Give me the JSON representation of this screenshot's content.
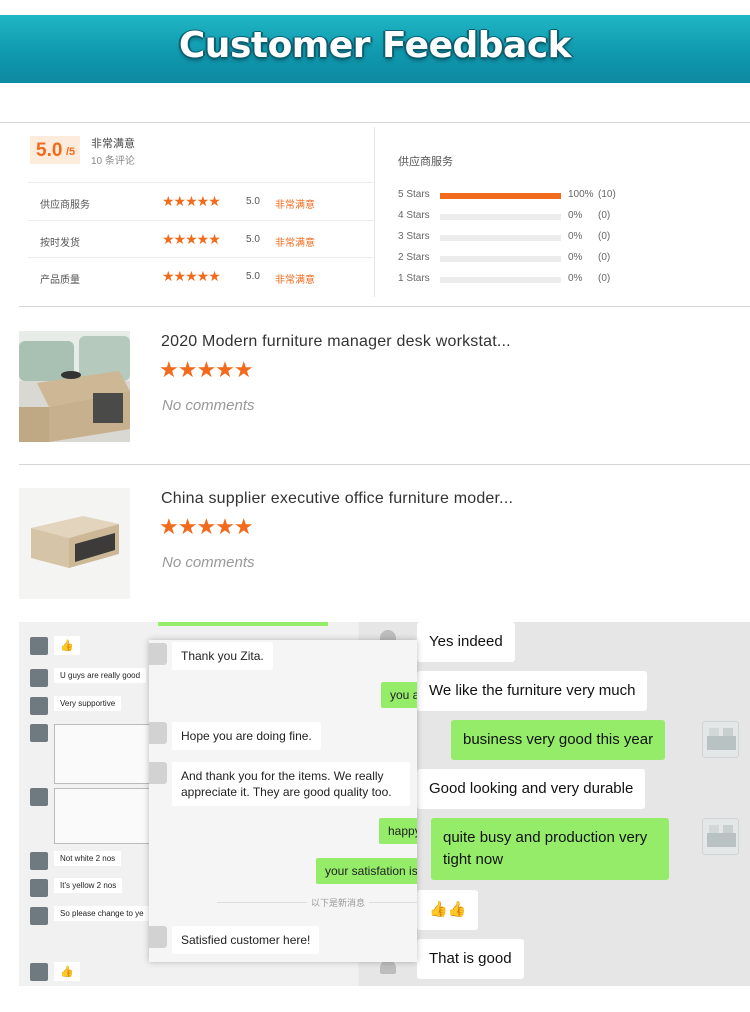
{
  "banner": {
    "title": "Customer Feedback"
  },
  "summary": {
    "score": "5.0",
    "score_suffix": "/5",
    "label": "非常满意",
    "count": "10 条评论",
    "rows": [
      {
        "label": "供应商服务",
        "stars": "★★★★★",
        "value": "5.0",
        "level": "非常满意"
      },
      {
        "label": "按时发货",
        "stars": "★★★★★",
        "value": "5.0",
        "level": "非常满意"
      },
      {
        "label": "产品质量",
        "stars": "★★★★★",
        "value": "5.0",
        "level": "非常满意"
      }
    ]
  },
  "distribution": {
    "title": "供应商服务",
    "rows": [
      {
        "label": "5 Stars",
        "fill": 1.0,
        "pct": "100%",
        "count": "(10)"
      },
      {
        "label": "4 Stars",
        "fill": 0,
        "pct": "0%",
        "count": "(0)"
      },
      {
        "label": "3 Stars",
        "fill": 0,
        "pct": "0%",
        "count": "(0)"
      },
      {
        "label": "2 Stars",
        "fill": 0,
        "pct": "0%",
        "count": "(0)"
      },
      {
        "label": "1 Stars",
        "fill": 0,
        "pct": "0%",
        "count": "(0)"
      }
    ]
  },
  "products": [
    {
      "title": "2020 Modern furniture manager desk workstat...",
      "stars": "★★★★★",
      "comment": "No comments"
    },
    {
      "title": "China supplier executive office furniture moder...",
      "stars": "★★★★★",
      "comment": "No comments"
    }
  ],
  "chat_left": {
    "messages": [
      "👍",
      "U guys are really good",
      "Very supportive",
      "Not white 2 nos",
      "It's yellow 2 nos",
      "So please change to ye",
      "👍"
    ]
  },
  "chat_popup": {
    "msg1": "Thank you Zita.",
    "green1": "you a",
    "msg2": "Hope you are doing fine.",
    "msg3": "And thank you for the items. We really appreciate it. They are good quality too.",
    "green2": "happy",
    "green3": "your satisfation is",
    "separator": "以下是新消息",
    "msg4": "Satisfied customer here!"
  },
  "chat_right": {
    "msg1": "Yes indeed",
    "msg2": "We like the furniture very much",
    "green1": "business very good this year",
    "msg3": "Good looking and very durable",
    "green2": "quite busy and production very tight now",
    "msg4": "👍👍",
    "msg5": "That is good"
  },
  "colors": {
    "accent": "#f26a1b",
    "banner": "#1398ad",
    "wechat_green": "#95ec69"
  }
}
